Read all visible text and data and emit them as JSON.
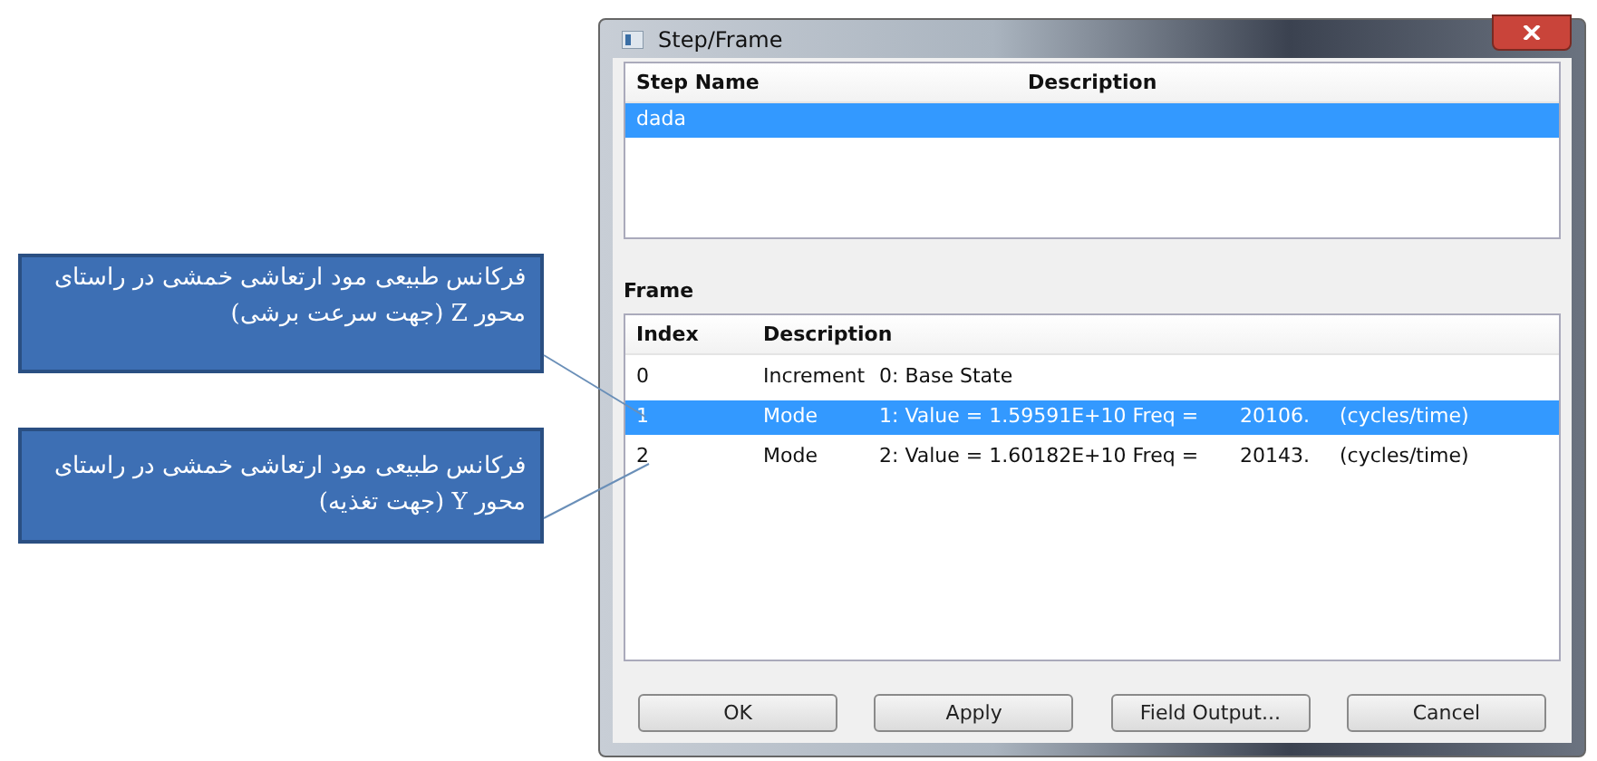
{
  "callouts": [
    {
      "text": "فرکانس طبیعی مود ارتعاشی خمشی در راستای محور Z (جهت سرعت برشی)"
    },
    {
      "text": "فرکانس طبیعی مود ارتعاشی خمشی در راستای محور Y  (جهت تغذیه)"
    }
  ],
  "window": {
    "title": "Step/Frame"
  },
  "steps": {
    "columns": [
      "Step Name",
      "Description"
    ],
    "rows": [
      {
        "name": "dada",
        "selected": true
      }
    ]
  },
  "frame": {
    "label": "Frame",
    "columns": [
      "Index",
      "Description"
    ],
    "rows": [
      {
        "index": "0",
        "type": "Increment",
        "description": "0: Base State",
        "selected": false
      },
      {
        "index": "1",
        "type": "Mode",
        "description": "1: Value =  1.59591E+10 Freq =",
        "freq": "20106.",
        "unit": "(cycles/time)",
        "selected": true
      },
      {
        "index": "2",
        "type": "Mode",
        "description": "2: Value =  1.60182E+10 Freq =",
        "freq": "20143.",
        "unit": "(cycles/time)",
        "selected": false
      }
    ]
  },
  "buttons": [
    "OK",
    "Apply",
    "Field Output...",
    "Cancel"
  ]
}
